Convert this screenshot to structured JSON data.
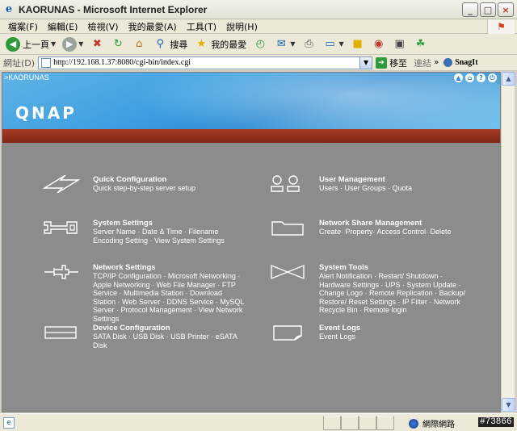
{
  "window": {
    "title": "KAORUNAS - Microsoft Internet Explorer",
    "buttons": [
      "_",
      "□",
      "×"
    ]
  },
  "menubar": {
    "items": [
      "檔案(F)",
      "編輯(E)",
      "檢視(V)",
      "我的最愛(A)",
      "工具(T)",
      "說明(H)"
    ]
  },
  "toolbar": {
    "back_label": "上一頁",
    "search_label": "搜尋",
    "favorites_label": "我的最愛"
  },
  "address": {
    "label": "網址(D)",
    "url": "http://192.168.1.37:8080/cgi-bin/index.cgi",
    "go_label": "移至",
    "links_label": "連結",
    "chevron": "»",
    "snagit_label": "SnagIt"
  },
  "page": {
    "breadcrumb": ">KAORUNAS",
    "logo": "QNAP"
  },
  "entries": [
    {
      "title": "Quick Configuration",
      "desc": "Quick step-by-step server setup"
    },
    {
      "title": "User Management",
      "desc": "Users · User Groups · Quota"
    },
    {
      "title": "System Settings",
      "desc": "Server Name · Date & Time · Filename Encoding Setting · View System Settings"
    },
    {
      "title": "Network Share Management",
      "desc": "Create· Property· Access Control· Delete"
    },
    {
      "title": "Network Settings",
      "desc": "TCP/IP Configuration · Microsoft Networking · Apple Networking · Web File Manager · FTP Service · Multimedia Station · Download Station · Web Server · DDNS Service · MySQL Server · Protocol Management · View Network Settings"
    },
    {
      "title": "System Tools",
      "desc": "Alert Notification · Restart/ Shutdown · Hardware Settings · UPS · System Update · Change Logo · Remote Replication · Backup/ Restore/ Reset Settings · IP Filter · Network Recycle Bin · Remote login"
    },
    {
      "title": "Device Configuration",
      "desc": "SATA Disk · USB Disk · USB Printer · eSATA Disk"
    },
    {
      "title": "Event Logs",
      "desc": "Event Logs"
    }
  ],
  "status": {
    "zone_label": "網際網路",
    "stamp": "#73866"
  },
  "colors": {
    "content_bg": "#8c8c8c",
    "header_blue": "#3d9fe0",
    "red_band": "#a53a24"
  }
}
